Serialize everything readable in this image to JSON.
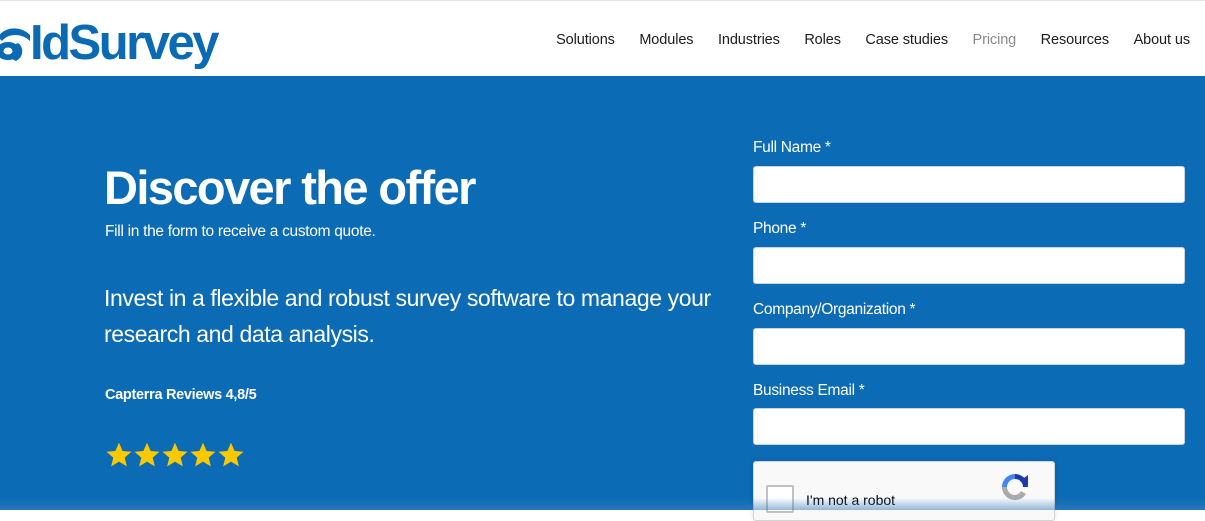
{
  "header": {
    "logo_text": "IdSurvey",
    "nav": [
      {
        "label": "Solutions",
        "muted": false
      },
      {
        "label": "Modules",
        "muted": false
      },
      {
        "label": "Industries",
        "muted": false
      },
      {
        "label": "Roles",
        "muted": false
      },
      {
        "label": "Case studies",
        "muted": false
      },
      {
        "label": "Pricing",
        "muted": true
      },
      {
        "label": "Resources",
        "muted": false
      },
      {
        "label": "About us",
        "muted": false
      }
    ]
  },
  "hero": {
    "title": "Discover the offer",
    "subtitle": "Fill in the form to receive a custom quote.",
    "lead": "Invest in a flexible and robust survey software to manage your research and data analysis.",
    "rating_label": "Capterra Reviews 4,8/5",
    "rating_stars": 5,
    "rating_max": 5
  },
  "form": {
    "fields": [
      {
        "label": "Full Name *",
        "value": "",
        "placeholder": ""
      },
      {
        "label": "Phone *",
        "value": "",
        "placeholder": ""
      },
      {
        "label": "Company/Organization *",
        "value": "",
        "placeholder": ""
      },
      {
        "label": "Business Email *",
        "value": "",
        "placeholder": ""
      }
    ],
    "captcha_label": "I'm not a robot"
  },
  "colors": {
    "brand_blue": "#0c6bb5",
    "star_yellow": "#fcc900",
    "nav_text": "#1c1c1c",
    "nav_muted": "#8a8a8a"
  }
}
